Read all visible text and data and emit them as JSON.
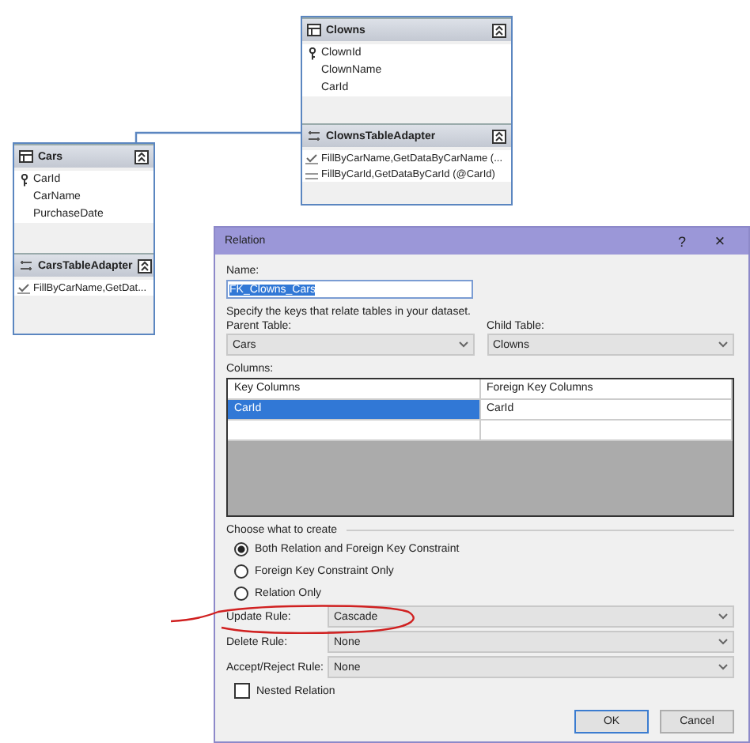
{
  "canvas": {
    "tables": [
      {
        "title": "Clowns",
        "columns": [
          {
            "name": "ClownId",
            "key": true
          },
          {
            "name": "ClownName",
            "key": false
          },
          {
            "name": "CarId",
            "key": false
          }
        ],
        "adapter": {
          "title": "ClownsTableAdapter",
          "queries": [
            {
              "text": "FillByCarName,GetDataByCarName (...",
              "kind": "checked"
            },
            {
              "text": "FillByCarId,GetDataByCarId (@CarId)",
              "kind": "plain"
            }
          ]
        }
      },
      {
        "title": "Cars",
        "columns": [
          {
            "name": "CarId",
            "key": true
          },
          {
            "name": "CarName",
            "key": false
          },
          {
            "name": "PurchaseDate",
            "key": false
          }
        ],
        "adapter": {
          "title": "CarsTableAdapter",
          "queries": [
            {
              "text": "FillByCarName,GetDat...",
              "kind": "checked"
            }
          ]
        }
      }
    ]
  },
  "dialog": {
    "title": "Relation",
    "help": "?",
    "close": "×",
    "name_label": "Name:",
    "name_value": "FK_Clowns_Cars",
    "name_text_selected": true,
    "instructions": "Specify the keys that relate tables in your dataset.",
    "parent_label": "Parent Table:",
    "parent_value": "Cars",
    "child_label": "Child Table:",
    "child_value": "Clowns",
    "columns_label": "Columns:",
    "grid_headers": [
      "Key Columns",
      "Foreign Key Columns"
    ],
    "grid_rows": [
      {
        "cells": [
          {
            "text": "CarId",
            "selected": true
          },
          {
            "text": "CarId",
            "selected": false
          }
        ]
      }
    ],
    "create_label": "Choose what to create",
    "create_options": [
      {
        "label": "Both Relation and Foreign Key Constraint",
        "selected": true
      },
      {
        "label": "Foreign Key Constraint Only",
        "selected": false
      },
      {
        "label": "Relation Only",
        "selected": false
      }
    ],
    "rules": [
      {
        "label": "Update Rule:",
        "value": "Cascade"
      },
      {
        "label": "Delete Rule:",
        "value": "None"
      },
      {
        "label": "Accept/Reject Rule:",
        "value": "None"
      }
    ],
    "nested": {
      "label": "Nested Relation",
      "checked": false
    },
    "buttons": [
      {
        "label": "OK",
        "default": true
      },
      {
        "label": "Cancel",
        "default": false
      }
    ]
  }
}
